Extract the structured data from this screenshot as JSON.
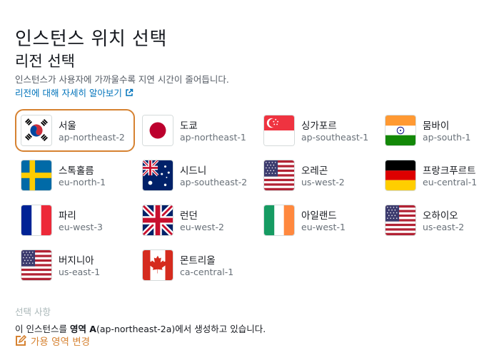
{
  "header": {
    "title": "인스턴스 위치 선택",
    "subtitle": "리전 선택",
    "description": "인스턴스가 사용자에 가까울수록 지연 시간이 줄어듭니다.",
    "learn_more": "리전에 대해 자세히 알아보기"
  },
  "regions": [
    {
      "name": "서울",
      "code": "ap-northeast-2",
      "flag": "korea-flag",
      "selected": true
    },
    {
      "name": "도쿄",
      "code": "ap-northeast-1",
      "flag": "japan-flag"
    },
    {
      "name": "싱가포르",
      "code": "ap-southeast-1",
      "flag": "singapore-flag"
    },
    {
      "name": "뭄바이",
      "code": "ap-south-1",
      "flag": "india-flag"
    },
    {
      "name": "스톡홀름",
      "code": "eu-north-1",
      "flag": "sweden-flag"
    },
    {
      "name": "시드니",
      "code": "ap-southeast-2",
      "flag": "australia-flag"
    },
    {
      "name": "오레곤",
      "code": "us-west-2",
      "flag": "usa-flag"
    },
    {
      "name": "프랑크푸르트",
      "code": "eu-central-1",
      "flag": "germany-flag"
    },
    {
      "name": "파리",
      "code": "eu-west-3",
      "flag": "france-flag"
    },
    {
      "name": "런던",
      "code": "eu-west-2",
      "flag": "uk-flag"
    },
    {
      "name": "아일랜드",
      "code": "eu-west-1",
      "flag": "ireland-flag"
    },
    {
      "name": "오하이오",
      "code": "us-east-2",
      "flag": "usa-flag"
    },
    {
      "name": "버지니아",
      "code": "us-east-1",
      "flag": "usa-flag"
    },
    {
      "name": "몬트리올",
      "code": "ca-central-1",
      "flag": "canada-flag"
    }
  ],
  "selection": {
    "label": "선택 사항",
    "text_prefix": "이 인스턴스를 ",
    "zone_word": "영역 A",
    "text_suffix": "(ap-northeast-2a)에서 생성하고 있습니다.",
    "change_label": "가용 영역 변경"
  },
  "colors": {
    "accent": "#d68231",
    "link": "#0073bb"
  }
}
